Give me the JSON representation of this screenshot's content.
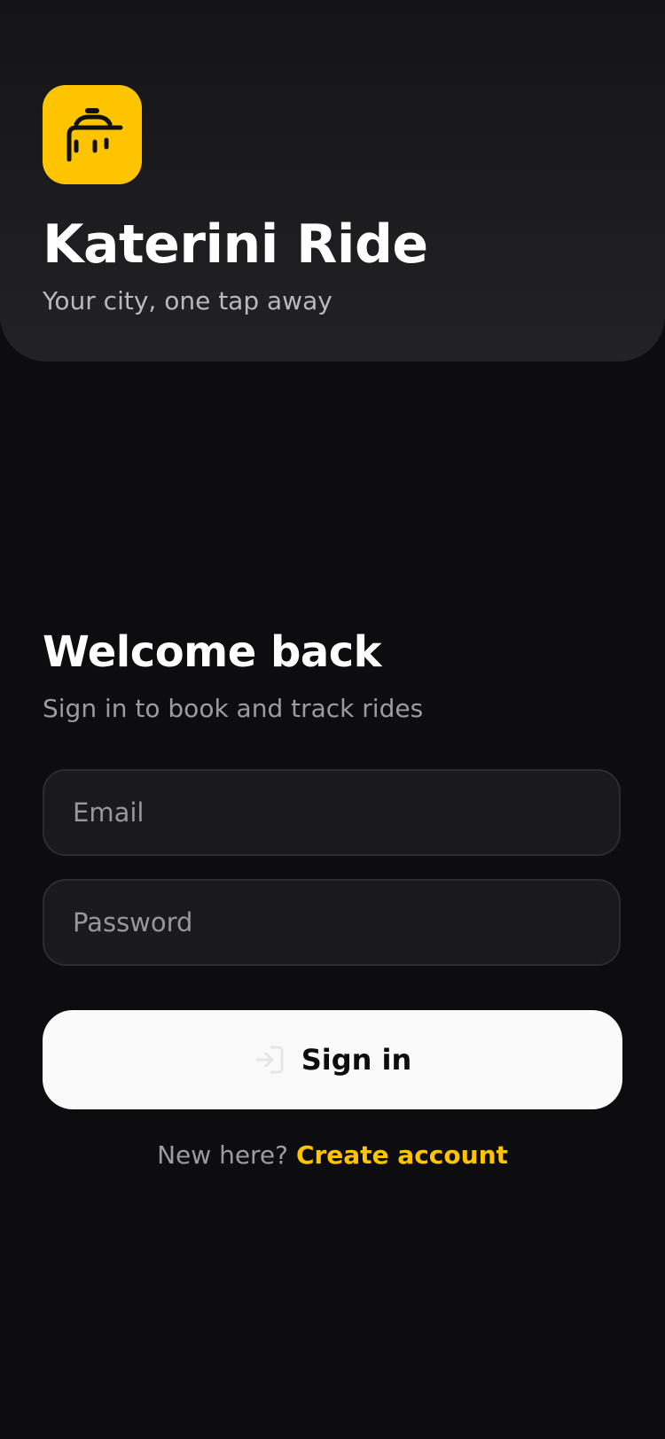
{
  "brand": {
    "app_name": "Katerini Ride",
    "tagline": "Your city, one tap away",
    "logo_icon": "taxi-icon",
    "accent_color": "#ffc400"
  },
  "login": {
    "heading": "Welcome back",
    "subheading": "Sign in to book and track rides",
    "email_placeholder": "Email",
    "email_value": "",
    "password_placeholder": "Password",
    "password_value": "",
    "submit_label": "Sign in",
    "submit_icon": "sign-in-icon"
  },
  "footer": {
    "prompt": "New here?",
    "link_label": "Create account"
  }
}
